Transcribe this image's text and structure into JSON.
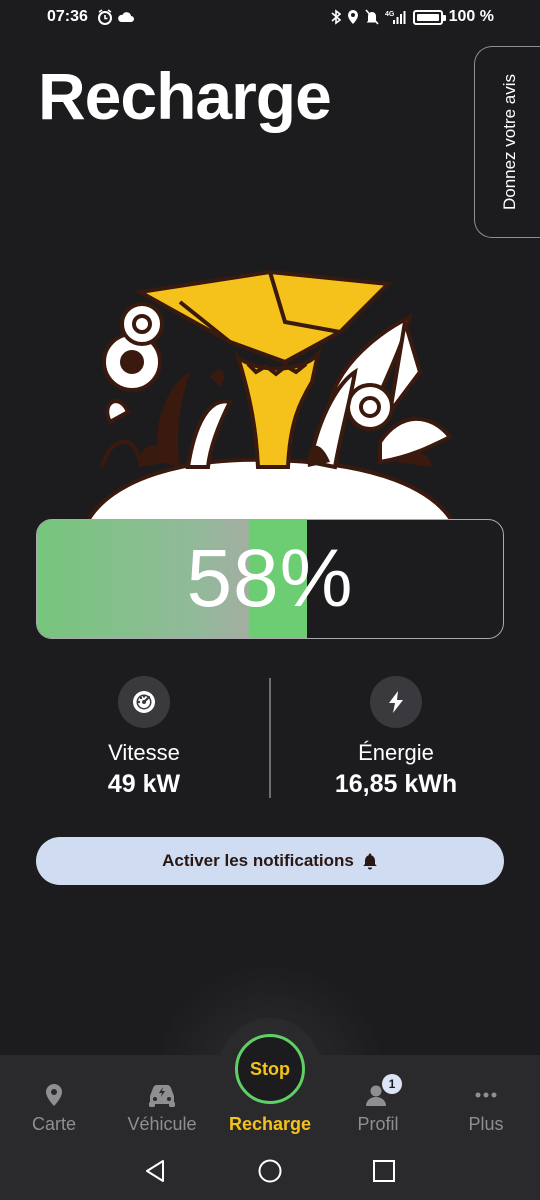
{
  "status_bar": {
    "time": "07:36",
    "left_icons": [
      "alarm-icon",
      "cloud-icon"
    ],
    "right_icons": [
      "bluetooth-icon",
      "location-icon",
      "mute-icon",
      "signal-4g-icon",
      "battery-icon"
    ],
    "battery": "100 %",
    "network": "4G"
  },
  "header": {
    "title": "Recharge",
    "feedback_label": "Donnez votre avis"
  },
  "charge": {
    "percent_text": "58%",
    "percent_value": 58,
    "fill_color": "#6ccd72"
  },
  "stats": {
    "speed": {
      "icon": "speedometer-icon",
      "label": "Vitesse",
      "value": "49 kW"
    },
    "energy": {
      "icon": "lightning-icon",
      "label": "Énergie",
      "value": "16,85 kWh"
    }
  },
  "notifications_button": {
    "label": "Activer les notifications",
    "icon": "bell-icon"
  },
  "stop_button": {
    "label": "Stop"
  },
  "bottom_nav": {
    "items": [
      {
        "label": "Carte",
        "icon": "map-pin-icon"
      },
      {
        "label": "Véhicule",
        "icon": "car-icon"
      },
      {
        "label": "Recharge",
        "icon": "stop-button",
        "active": true
      },
      {
        "label": "Profil",
        "icon": "profile-icon",
        "badge": "1"
      },
      {
        "label": "Plus",
        "icon": "more-dots-icon"
      }
    ]
  },
  "colors": {
    "background": "#1c1c1e",
    "accent_yellow": "#f4c21a",
    "accent_green": "#6ccd72",
    "notif_button_bg": "#cfdcf2"
  }
}
